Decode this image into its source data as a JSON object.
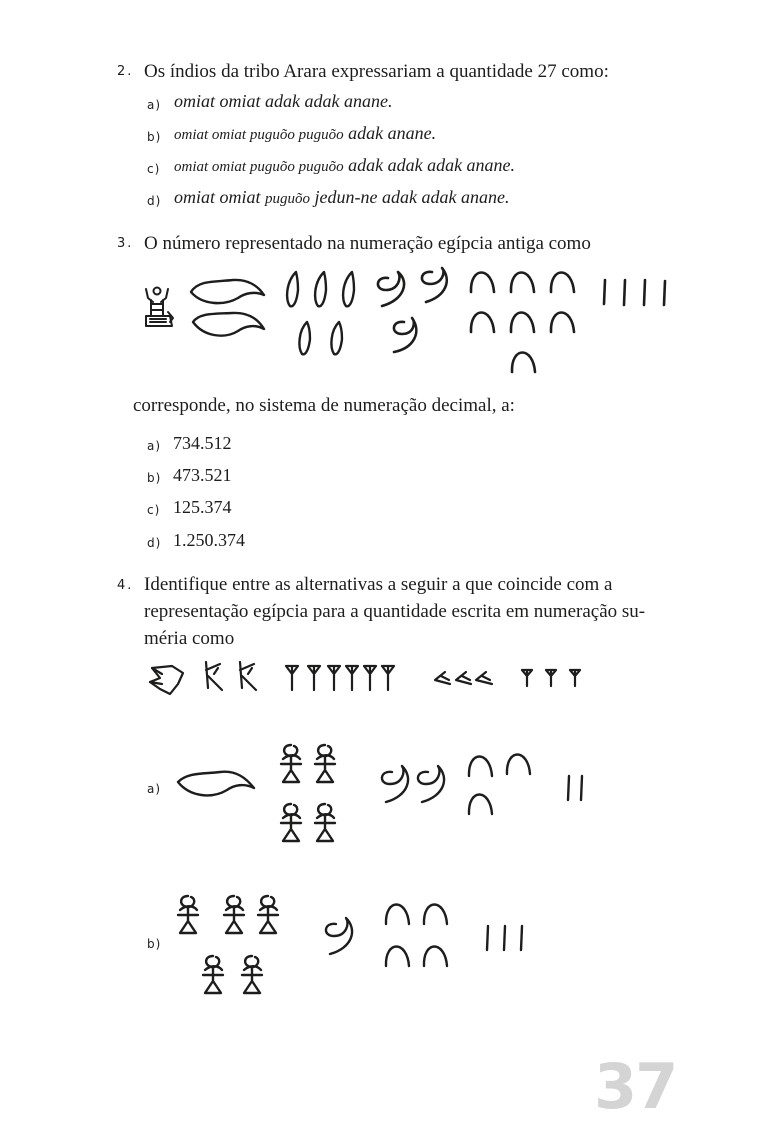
{
  "q2": {
    "number": "2.",
    "text": "Os índios da tribo Arara expressariam a quantidade 27 como:",
    "options": [
      {
        "label": "a)",
        "parts": [
          "omiat omiat adak adak anane."
        ]
      },
      {
        "label": "b)",
        "parts": [
          "omiat omiat puguõo puguõo",
          " adak anane."
        ]
      },
      {
        "label": "c)",
        "parts": [
          "omiat omiat puguõo puguõo",
          " adak adak adak anane."
        ]
      },
      {
        "label": "d)",
        "parts": [
          "omiat omiat ",
          "puguõo",
          " jedun-ne adak adak anane."
        ]
      }
    ]
  },
  "q3": {
    "number": "3.",
    "text": "O número representado na numeração egípcia antiga como",
    "continuation": "corresponde, no sistema de numeração decimal, a:",
    "options": [
      {
        "label": "a)",
        "value": "734.512"
      },
      {
        "label": "b)",
        "value": "473.521"
      },
      {
        "label": "c)",
        "value": "125.374"
      },
      {
        "label": "d)",
        "value": "1.250.374"
      }
    ]
  },
  "q4": {
    "number": "4.",
    "text_line1": "Identifique entre as alternativas a seguir a que coincide com a",
    "text_line2": "representação egípcia para a quantidade escrita em numeração su-",
    "text_line3": "méria como",
    "options": [
      {
        "label": "a)"
      },
      {
        "label": "b)"
      }
    ]
  },
  "page_number": "37"
}
